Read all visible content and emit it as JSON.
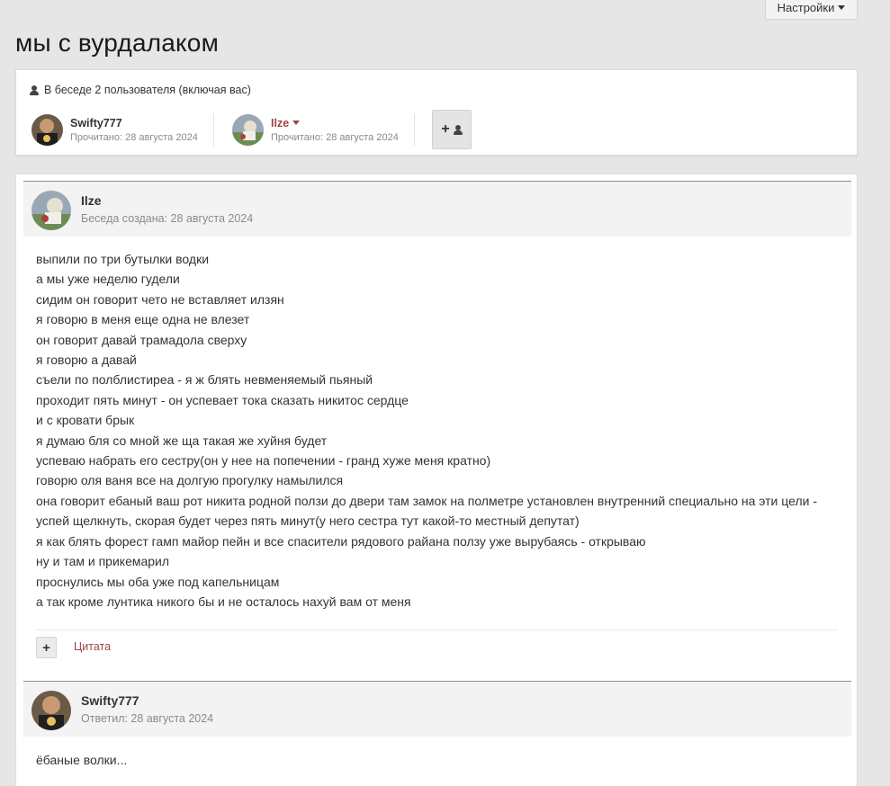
{
  "header": {
    "settings_label": "Настройки",
    "page_title": "мы с вурдалаком"
  },
  "participants": {
    "heading": "В беседе 2 пользователя (включая вас)",
    "users": [
      {
        "name": "Swifty777",
        "read": "Прочитано: 28 августа 2024"
      },
      {
        "name": "Ilze",
        "read": "Прочитано: 28 августа 2024"
      }
    ],
    "add_button_glyph": "+"
  },
  "posts": [
    {
      "author": "Ilze",
      "meta": "Беседа создана: 28 августа 2024",
      "lines": [
        "выпили по три бутылки водки",
        "а мы уже неделю гудели",
        "сидим он говорит чето не вставляет илзян",
        "я говорю в меня еще одна не влезет",
        "он говорит давай трамадола сверху",
        "я говорю а давай",
        "съели по полблистиреа - я ж блять невменяемый пьяный",
        "проходит пять минут - он успевает тока сказать никитос сердце",
        "и с кровати брык",
        "я думаю бля со мной же ща такая же хуйня будет",
        "успеваю набрать его сестру(он у нее на попечении - гранд хуже меня кратно)",
        "говорю оля ваня все на долгую прогулку намылился",
        "она говорит ебаный ваш рот никита родной ползи до двери там замок на полметре установлен внутренний специально на эти цели -",
        "успей щелкнуть, скорая будет через пять минут(у него сестра тут какой-то местный депутат)",
        "я как блять форест гамп майор пейн и все спасители рядового райана ползу уже вырубаясь - открываю",
        "ну и там и прикемарил",
        "проснулись мы оба уже под капельницам",
        "а так кроме лунтика никого бы и не осталось нахуй вам от меня"
      ],
      "plus_glyph": "+",
      "quote_label": "Цитата"
    },
    {
      "author": "Swifty777",
      "meta": "Ответил: 28 августа 2024",
      "lines": [
        "ёбаные волки..."
      ]
    }
  ],
  "colors": {
    "accent": "#9b4747",
    "background": "#e6e6e6"
  }
}
